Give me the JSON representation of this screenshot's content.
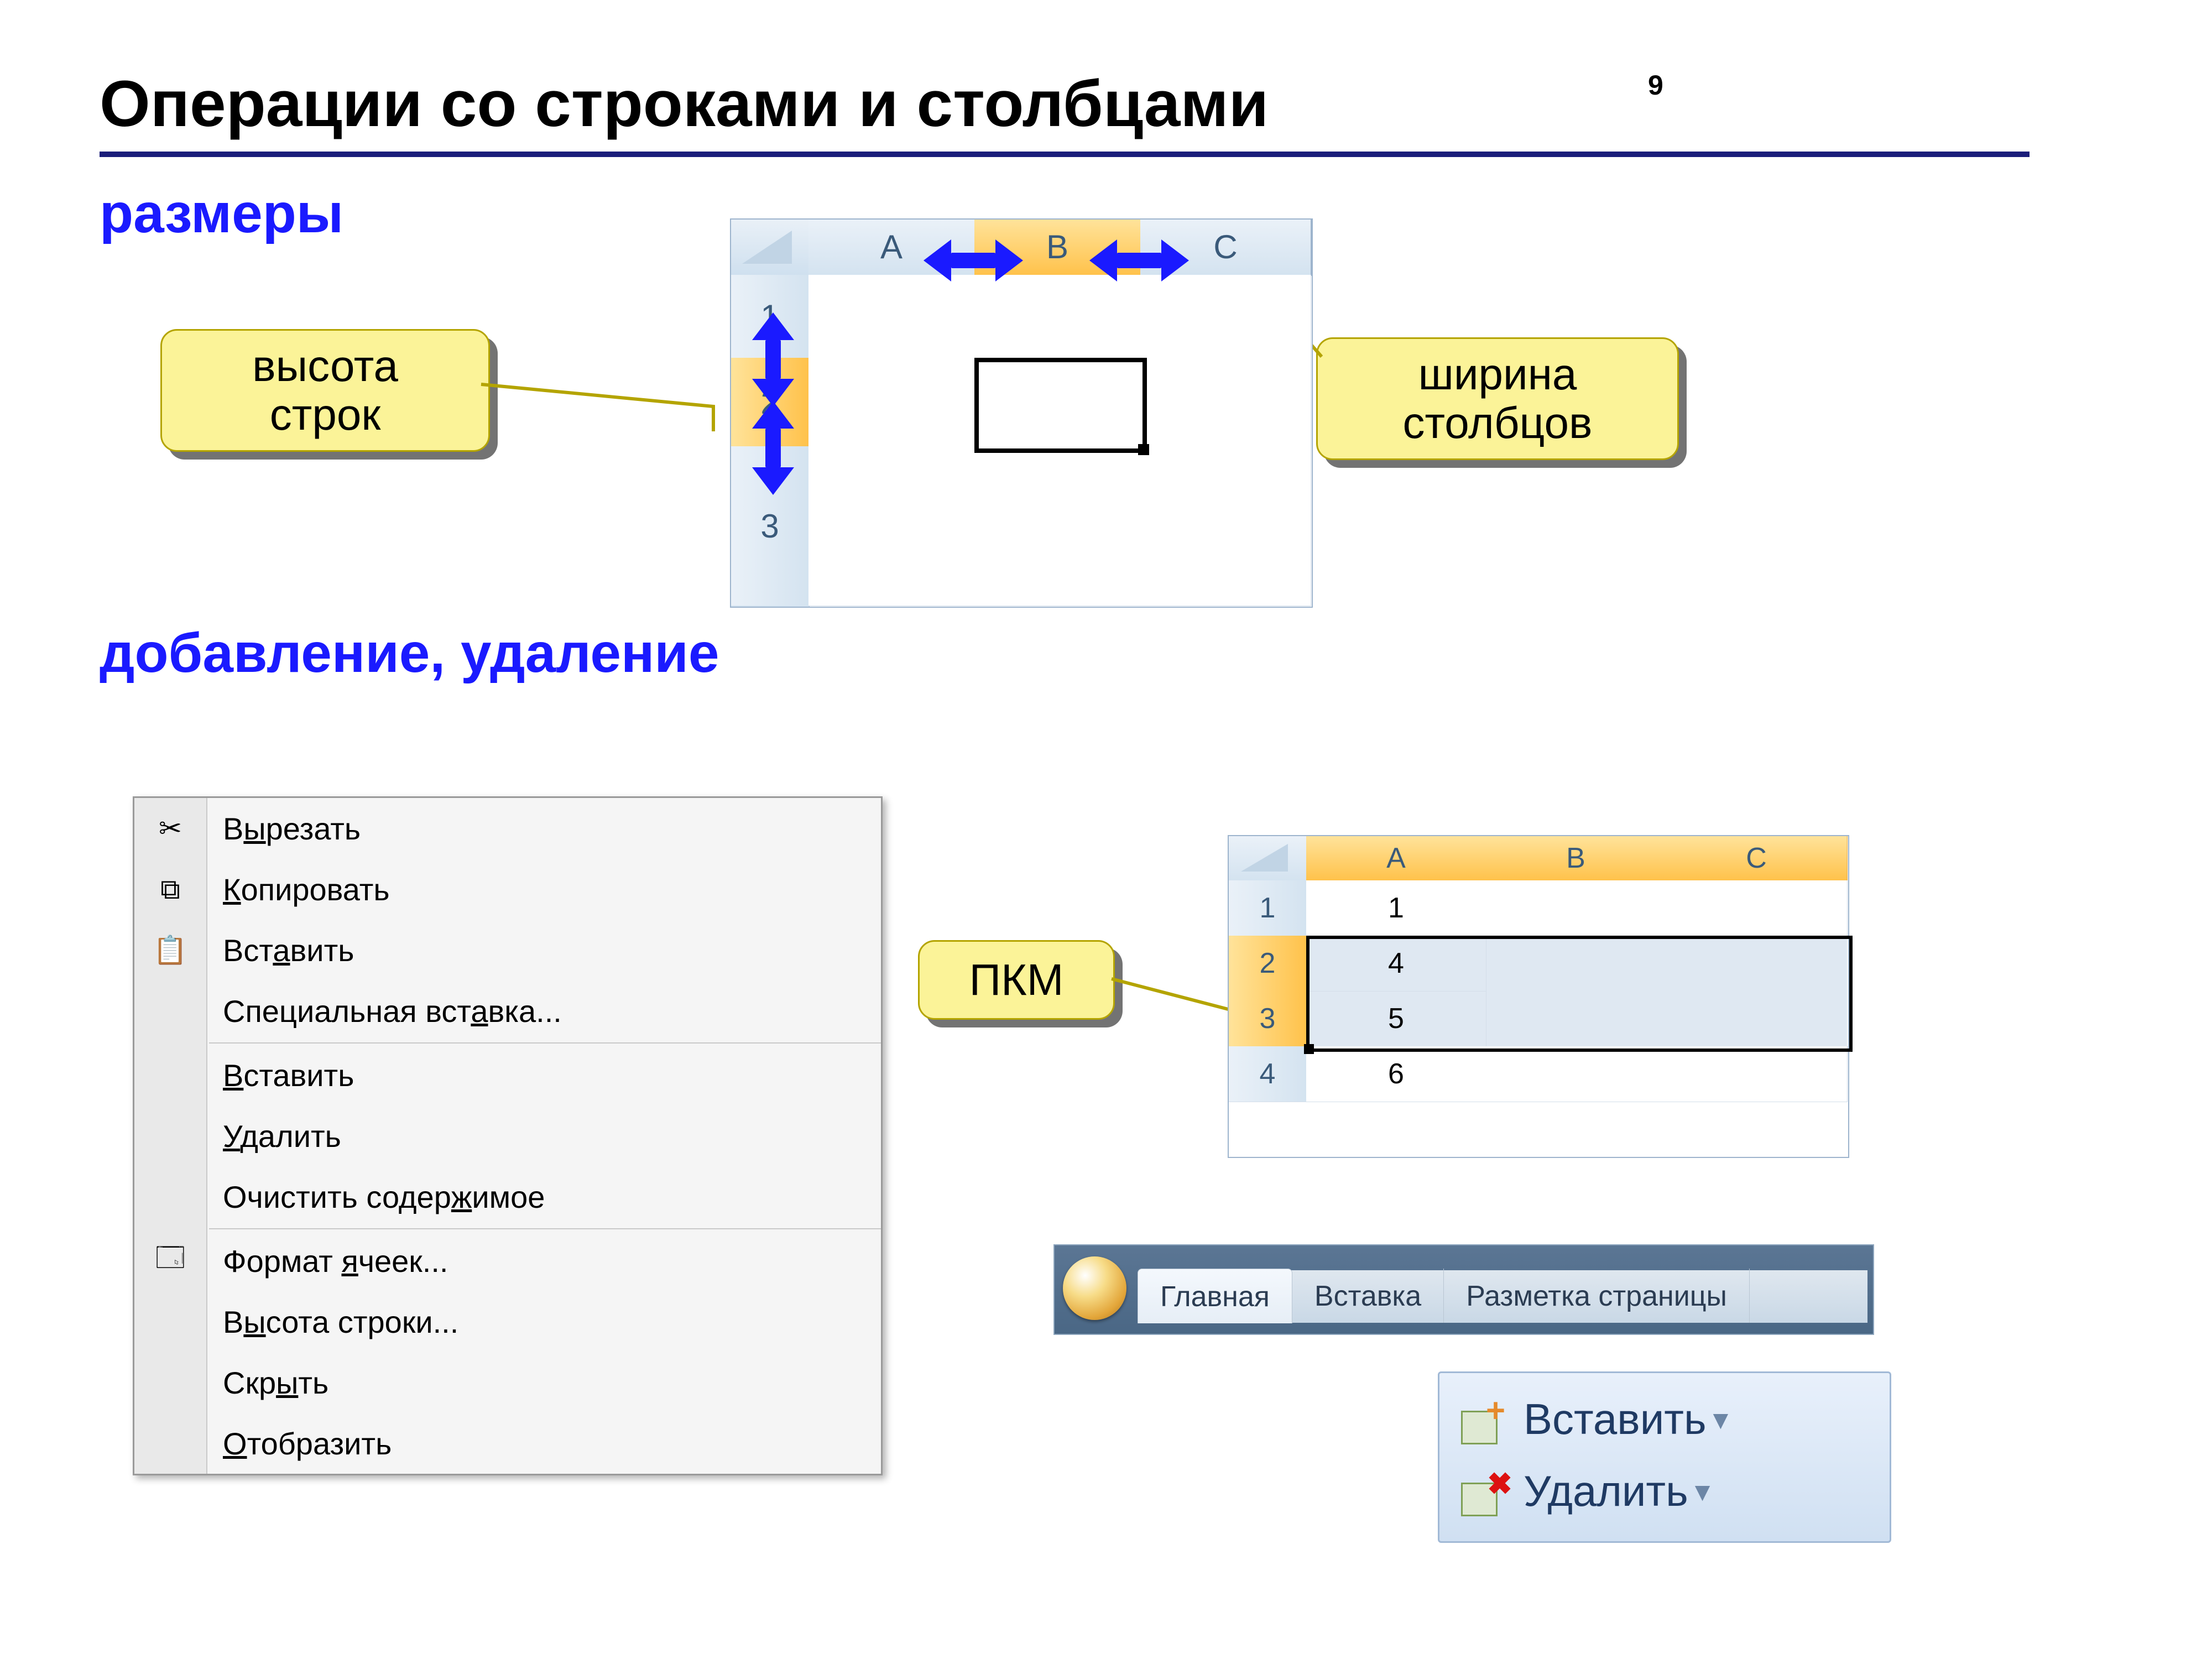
{
  "page_number": "9",
  "title": "Операции со строками и столбцами",
  "section_sizes": "размеры",
  "section_add_del": "добавление, удаление",
  "callout_row_height_l1": "высота",
  "callout_row_height_l2": "строк",
  "callout_col_width_l1": "ширина",
  "callout_col_width_l2": "столбцов",
  "callout_rmb": "ПКМ",
  "grid1": {
    "cols": [
      "A",
      "B",
      "C"
    ],
    "rows": [
      "1",
      "2",
      "3"
    ]
  },
  "grid2": {
    "cols": [
      "A",
      "B",
      "C"
    ],
    "rows": [
      "1",
      "2",
      "3",
      "4"
    ],
    "colA": [
      "1",
      "4",
      "5",
      "6"
    ]
  },
  "context_menu": {
    "cut": {
      "pre": "В",
      "u": "ы",
      "post": "резать"
    },
    "copy": {
      "pre": "",
      "u": "К",
      "post": "опировать"
    },
    "paste": {
      "pre": "Вст",
      "u": "а",
      "post": "вить"
    },
    "paste_special": {
      "pre": "Специальная вст",
      "u": "а",
      "post": "вка..."
    },
    "insert": {
      "pre": "",
      "u": "В",
      "post": "ставить"
    },
    "delete": {
      "pre": "",
      "u": "У",
      "post": "далить"
    },
    "clear": {
      "pre": "Очистить содер",
      "u": "ж",
      "post": "имое"
    },
    "format": {
      "pre": "Формат ",
      "u": "я",
      "post": "чеек..."
    },
    "row_height": {
      "pre": "В",
      "u": "ы",
      "post": "сота строки..."
    },
    "hide": {
      "pre": "Скр",
      "u": "ы",
      "post": "ть"
    },
    "unhide": {
      "pre": "",
      "u": "О",
      "post": "тобразить"
    }
  },
  "ribbon": {
    "home": "Главная",
    "insert": "Вставка",
    "layout": "Разметка страницы"
  },
  "buttons": {
    "insert": "Вставить",
    "delete": "Удалить"
  }
}
